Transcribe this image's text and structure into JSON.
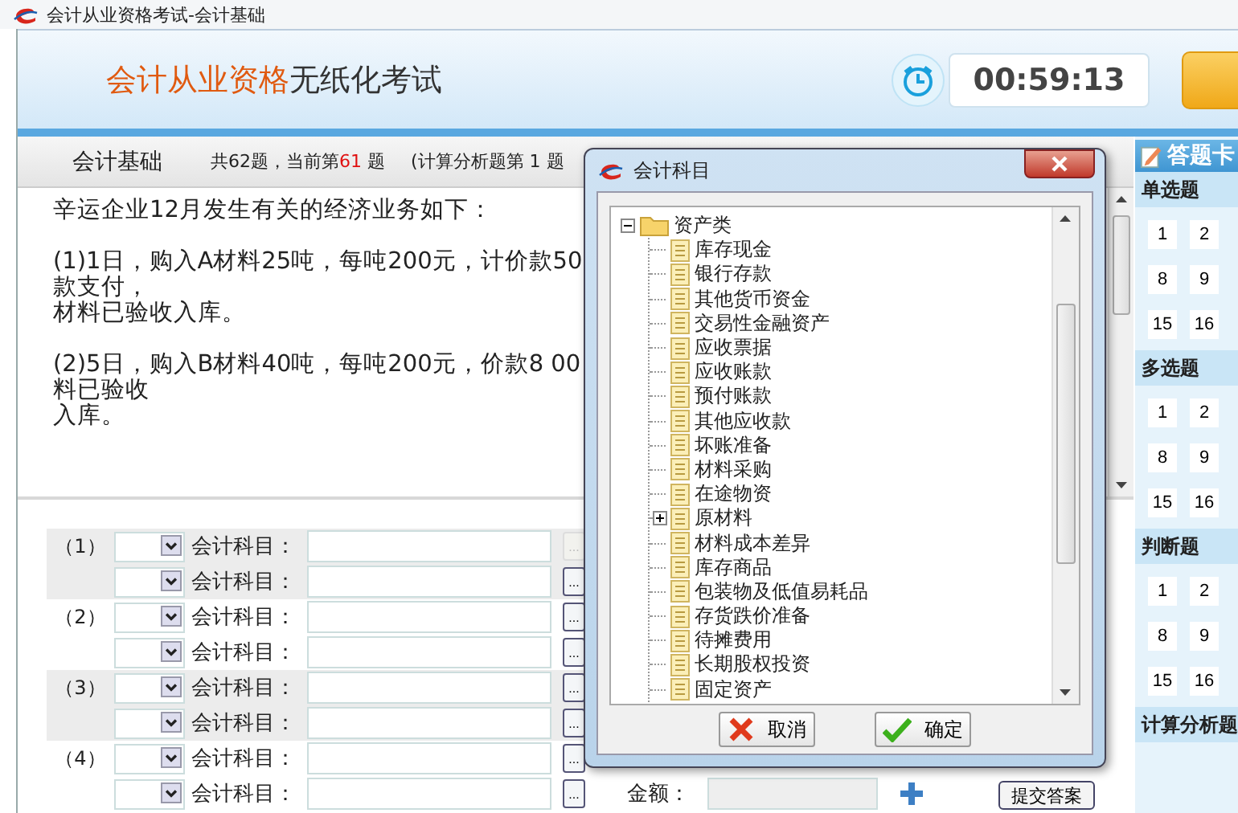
{
  "window": {
    "title": "会计从业资格考试-会计基础"
  },
  "header": {
    "brand_highlight": "会计从业资格",
    "brand_rest": "无纸化考试",
    "timer": "00:59:13"
  },
  "info_bar": {
    "subject": "会计基础",
    "progress_prefix": "共62题，当前第",
    "current": "61",
    "progress_suffix": "题",
    "section": "(计算分析题第 1 题"
  },
  "question": {
    "paragraphs": [
      {
        "lines": [
          "辛运企业12月发生有关的经济业务如下："
        ]
      },
      {
        "lines": [
          "(1)1日，购入A材料25吨，每吨200元，计价款50",
          "款支付，",
          "材料已验收入库。"
        ]
      },
      {
        "lines": [
          "(2)5日，购入B材料40吨，每吨200元，价款8 00",
          "料已验收",
          "入库。"
        ]
      }
    ]
  },
  "entry_groups": [
    {
      "label": "（1）",
      "lines": [
        {
          "account_label": "会计科目：",
          "browse": "...",
          "disabled": true
        },
        {
          "account_label": "会计科目：",
          "browse": "...",
          "disabled": false
        }
      ]
    },
    {
      "label": "（2）",
      "lines": [
        {
          "account_label": "会计科目：",
          "browse": "...",
          "disabled": false
        },
        {
          "account_label": "会计科目：",
          "browse": "...",
          "disabled": false
        }
      ]
    },
    {
      "label": "（3）",
      "lines": [
        {
          "account_label": "会计科目：",
          "browse": "...",
          "disabled": false
        },
        {
          "account_label": "会计科目：",
          "browse": "...",
          "disabled": false
        }
      ]
    },
    {
      "label": "（4）",
      "lines": [
        {
          "account_label": "会计科目：",
          "browse": "...",
          "disabled": false
        },
        {
          "account_label": "会计科目：",
          "browse": "...",
          "disabled": false,
          "amount_label": "金额：",
          "action": "提交答案"
        }
      ]
    }
  ],
  "answer_card": {
    "title": "答题卡",
    "sections": [
      {
        "title": "单选题",
        "numbers": [
          "1",
          "2",
          "8",
          "9",
          "15",
          "16"
        ]
      },
      {
        "title": "多选题",
        "numbers": [
          "1",
          "2",
          "8",
          "9",
          "15",
          "16"
        ]
      },
      {
        "title": "判断题",
        "numbers": [
          "1",
          "2",
          "8",
          "9",
          "15",
          "16"
        ]
      },
      {
        "title": "计算分析题"
      }
    ]
  },
  "dialog": {
    "title": "会计科目",
    "tree": [
      {
        "label": "资产类",
        "expanded": true,
        "children": [
          {
            "label": "库存现金"
          },
          {
            "label": "银行存款"
          },
          {
            "label": "其他货币资金"
          },
          {
            "label": "交易性金融资产"
          },
          {
            "label": "应收票据"
          },
          {
            "label": "应收账款"
          },
          {
            "label": "预付账款"
          },
          {
            "label": "其他应收款"
          },
          {
            "label": "坏账准备"
          },
          {
            "label": "材料采购"
          },
          {
            "label": "在途物资"
          },
          {
            "label": "原材料",
            "expanded": false
          },
          {
            "label": "材料成本差异"
          },
          {
            "label": "库存商品"
          },
          {
            "label": "包装物及低值易耗品"
          },
          {
            "label": "存货跌价准备"
          },
          {
            "label": "待摊费用"
          },
          {
            "label": "长期股权投资"
          },
          {
            "label": "固定资产"
          }
        ]
      }
    ],
    "buttons": [
      {
        "kind": "cancel",
        "label": "取消"
      },
      {
        "kind": "ok",
        "label": "确定"
      }
    ]
  }
}
